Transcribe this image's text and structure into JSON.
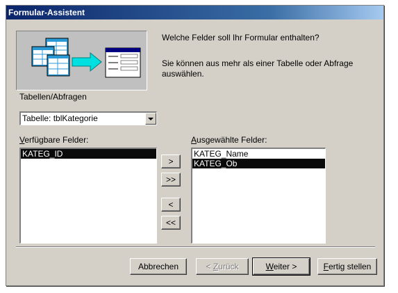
{
  "window": {
    "title": "Formular-Assistent"
  },
  "header": {
    "question": "Welche Felder soll Ihr Formular enthalten?",
    "hint": "Sie können aus mehr als einer Tabelle oder Abfrage auswählen."
  },
  "source": {
    "label": "Tabellen/Abfragen",
    "selected": "Tabelle: tblKategorie"
  },
  "available": {
    "label_mnemonic": "V",
    "label_rest": "erfügbare Felder:",
    "items": [
      "KATEG_ID"
    ]
  },
  "selected_fields": {
    "label_mnemonic": "A",
    "label_rest": "usgewählte Felder:",
    "items": [
      "KATEG_Name",
      "KATEG_Ob"
    ]
  },
  "move_buttons": {
    "add_one": ">",
    "add_all": ">>",
    "remove_one": "<",
    "remove_all": "<<"
  },
  "footer": {
    "cancel": "Abbrechen",
    "back_prefix": "< ",
    "back_mnemonic": "Z",
    "back_rest": "urück",
    "next_mnemonic": "W",
    "next_rest": "eiter >",
    "finish_mnemonic": "F",
    "finish_rest": "ertig stellen"
  }
}
